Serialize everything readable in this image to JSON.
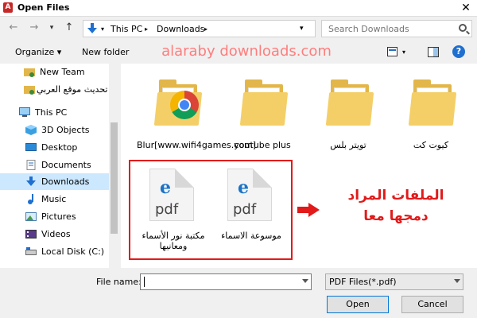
{
  "window": {
    "title": "Open Files",
    "close_glyph": "✕",
    "app_icon_text": "A"
  },
  "address": {
    "crumbs": [
      "This PC",
      "Downloads"
    ],
    "crumb_chevron": "▸",
    "dropdown_glyph": "▾"
  },
  "search": {
    "placeholder": "Search Downloads"
  },
  "toolbar": {
    "organize_label": "Organize ▾",
    "new_folder_label": "New folder",
    "help_glyph": "?"
  },
  "watermark": "alaraby downloads.com",
  "sidebar": {
    "items": [
      {
        "label": "New Team",
        "icon": "network-folder-icon"
      },
      {
        "label": "تحديث موقع العربي",
        "icon": "network-folder-icon"
      },
      {
        "label": "This PC",
        "icon": "computer-icon"
      },
      {
        "label": "3D Objects",
        "icon": "cube-icon"
      },
      {
        "label": "Desktop",
        "icon": "desktop-icon"
      },
      {
        "label": "Documents",
        "icon": "documents-icon"
      },
      {
        "label": "Downloads",
        "icon": "download-icon",
        "selected": true
      },
      {
        "label": "Music",
        "icon": "music-icon"
      },
      {
        "label": "Pictures",
        "icon": "pictures-icon"
      },
      {
        "label": "Videos",
        "icon": "videos-icon"
      },
      {
        "label": "Local Disk (C:)",
        "icon": "disk-icon"
      }
    ]
  },
  "files": {
    "folders": [
      {
        "name": "Blur[www.wifi4games.com]",
        "type": "chrome-folder"
      },
      {
        "name": "youtube plus",
        "type": "folder"
      },
      {
        "name": "تويتر بلس",
        "type": "folder"
      },
      {
        "name": "كيوت كت",
        "type": "folder"
      }
    ],
    "pdfs": [
      {
        "name": "مكتبة نور الأسماء ومعانيها",
        "ext": "pdf",
        "logo": "e"
      },
      {
        "name": "موسوعة الاسماء",
        "ext": "pdf",
        "logo": "e"
      }
    ]
  },
  "annotation": {
    "line1": "الملفات المراد",
    "line2": "دمجها معا",
    "color": "#e21a1a"
  },
  "bottom": {
    "filename_label": "File name:",
    "filename_value": "",
    "filter_value": "PDF Files(*.pdf)",
    "open_label": "Open",
    "cancel_label": "Cancel"
  }
}
